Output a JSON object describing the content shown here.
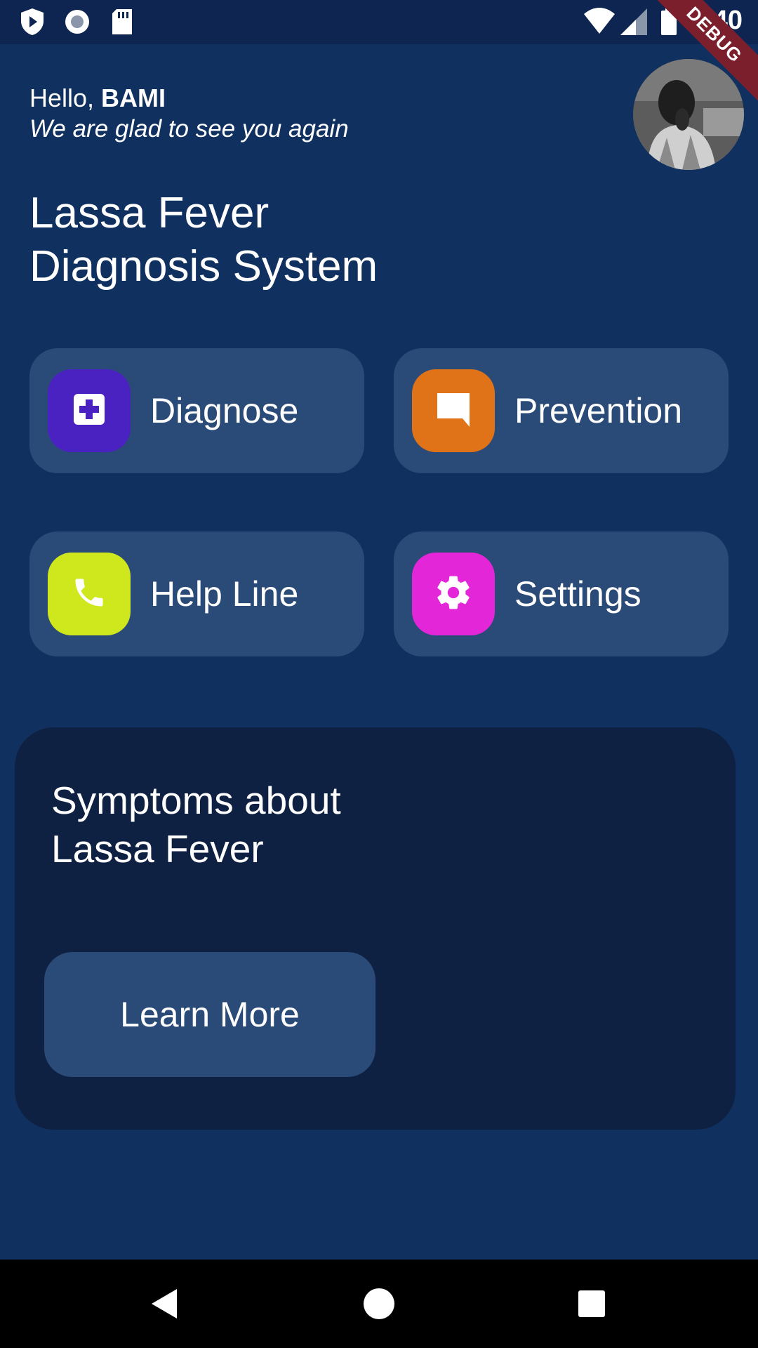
{
  "status_bar": {
    "time": "9:40",
    "icons": [
      "play-protect-icon",
      "record-icon",
      "sd-card-icon",
      "wifi-icon",
      "signal-icon",
      "battery-icon"
    ]
  },
  "debug_banner": "DEBUG",
  "header": {
    "greeting_prefix": "Hello, ",
    "user_name": "BAMI",
    "subtitle": "We are glad to see you again",
    "avatar_icon": "user-avatar"
  },
  "page_title_line1": "Lassa Fever",
  "page_title_line2": "Diagnosis System",
  "menu": [
    {
      "label": "Diagnose",
      "icon": "medical-cross-icon",
      "color": "#4b22c2"
    },
    {
      "label": "Prevention",
      "icon": "chat-bubble-icon",
      "color": "#e07318"
    },
    {
      "label": "Help Line",
      "icon": "phone-icon",
      "color": "#cfe81e"
    },
    {
      "label": "Settings",
      "icon": "gear-icon",
      "color": "#e426d9"
    }
  ],
  "symptoms": {
    "title_line1": "Symptoms about",
    "title_line2": "Lassa Fever",
    "button_label": "Learn More"
  },
  "nav": {
    "icons": [
      "back-icon",
      "home-icon",
      "recents-icon"
    ]
  },
  "colors": {
    "background": "#10305f",
    "card": "#2a4a77",
    "panel": "#0e2142",
    "status_bar": "#0d2550"
  }
}
